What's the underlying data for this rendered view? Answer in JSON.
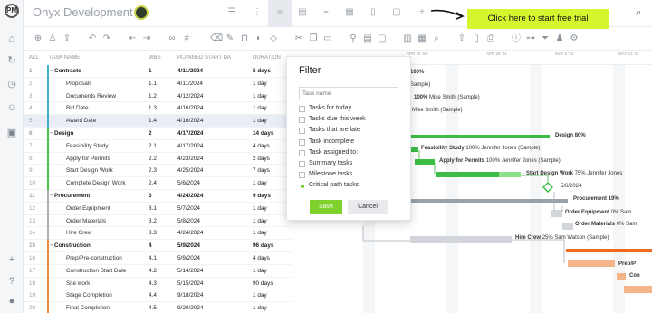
{
  "app": {
    "project_title": "Onyx Development",
    "cta_label": "Click here to start free trial"
  },
  "grid": {
    "columns": [
      "ALL",
      "TASK NAME",
      "WBS",
      "PLANNED START DA",
      "DURATION"
    ],
    "rows": [
      {
        "num": "1",
        "name": "Contracts",
        "wbs": "1",
        "start": "4/11/2024",
        "dur": "5 days",
        "group": true,
        "color": "#3fb0c9"
      },
      {
        "num": "2",
        "name": "Proposals",
        "wbs": "1.1",
        "start": "4/11/2024",
        "dur": "1 day",
        "group": false,
        "color": "#3fb0c9"
      },
      {
        "num": "3",
        "name": "Documents Review",
        "wbs": "1.2",
        "start": "4/12/2024",
        "dur": "1 day",
        "group": false,
        "color": "#3fb0c9"
      },
      {
        "num": "4",
        "name": "Bid Date",
        "wbs": "1.3",
        "start": "4/16/2024",
        "dur": "1 day",
        "group": false,
        "color": "#3fb0c9"
      },
      {
        "num": "5",
        "name": "Award Date",
        "wbs": "1.4",
        "start": "4/16/2024",
        "dur": "1 day",
        "group": false,
        "color": "#3fb0c9",
        "selected": true
      },
      {
        "num": "6",
        "name": "Design",
        "wbs": "2",
        "start": "4/17/2024",
        "dur": "14 days",
        "group": true,
        "color": "#4cc34a"
      },
      {
        "num": "7",
        "name": "Feasibility Study",
        "wbs": "2.1",
        "start": "4/17/2024",
        "dur": "4 days",
        "group": false,
        "color": "#4cc34a"
      },
      {
        "num": "8",
        "name": "Apply for Permits",
        "wbs": "2.2",
        "start": "4/23/2024",
        "dur": "2 days",
        "group": false,
        "color": "#4cc34a"
      },
      {
        "num": "9",
        "name": "Start Design Work",
        "wbs": "2.3",
        "start": "4/25/2024",
        "dur": "7 days",
        "group": false,
        "color": "#4cc34a"
      },
      {
        "num": "10",
        "name": "Complete Design Work",
        "wbs": "2.4",
        "start": "5/6/2024",
        "dur": "1 day",
        "group": false,
        "color": "#4cc34a"
      },
      {
        "num": "11",
        "name": "Procurement",
        "wbs": "3",
        "start": "4/24/2024",
        "dur": "9 days",
        "group": true,
        "color": "#a9b0b8"
      },
      {
        "num": "12",
        "name": "Order Equipment",
        "wbs": "3.1",
        "start": "5/7/2024",
        "dur": "1 day",
        "group": false,
        "color": "#a9b0b8"
      },
      {
        "num": "13",
        "name": "Order Materials",
        "wbs": "3.2",
        "start": "5/8/2024",
        "dur": "1 day",
        "group": false,
        "color": "#a9b0b8"
      },
      {
        "num": "14",
        "name": "Hire Crew",
        "wbs": "3.3",
        "start": "4/24/2024",
        "dur": "1 day",
        "group": false,
        "color": "#a9b0b8"
      },
      {
        "num": "15",
        "name": "Construction",
        "wbs": "4",
        "start": "5/9/2024",
        "dur": "96 days",
        "group": true,
        "color": "#ef8a3c"
      },
      {
        "num": "16",
        "name": "Prep/Pre-construction",
        "wbs": "4.1",
        "start": "5/9/2024",
        "dur": "4 days",
        "group": false,
        "color": "#ef8a3c"
      },
      {
        "num": "17",
        "name": "Construction Start Date",
        "wbs": "4.2",
        "start": "5/14/2024",
        "dur": "1 day",
        "group": false,
        "color": "#ef8a3c"
      },
      {
        "num": "18",
        "name": "Site work",
        "wbs": "4.3",
        "start": "5/15/2024",
        "dur": "90 days",
        "group": false,
        "color": "#ef8a3c"
      },
      {
        "num": "19",
        "name": "Stage Completion",
        "wbs": "4.4",
        "start": "9/18/2024",
        "dur": "1 day",
        "group": false,
        "color": "#ef8a3c"
      },
      {
        "num": "20",
        "name": "Final Completion",
        "wbs": "4.5",
        "start": "9/20/2024",
        "dur": "1 day",
        "group": false,
        "color": "#ef8a3c"
      }
    ]
  },
  "gantt": {
    "header_dates": [
      "APR 28 '24",
      "APR 28 '24",
      "MAY 5 '24",
      "MAY 12 '24"
    ],
    "labels": [
      {
        "text": "100%",
        "extra": ""
      },
      {
        "text": "",
        "extra": "Sample)"
      },
      {
        "text": "100%",
        "extra": "Mike Smith (Sample)"
      },
      {
        "text": "",
        "extra": "Mike Smith (Sample)"
      },
      {
        "text": "Design",
        "extra": "80%"
      },
      {
        "text": "Feasibility Study",
        "extra": "100%  Jennifer Jones (Sample)"
      },
      {
        "text": "Apply for Permits",
        "extra": "100%  Jennifer Jones (Sample)"
      },
      {
        "text": "Start Design Work",
        "extra": "75%  Jennifer Jones"
      },
      {
        "text": "5/6/2024",
        "extra": ""
      },
      {
        "text": "Procurement",
        "extra": "19%"
      },
      {
        "text": "Order Equipment",
        "extra": "0%  Sam"
      },
      {
        "text": "Order Materials",
        "extra": "0%  Sam"
      },
      {
        "text": "Hire Crew",
        "extra": "25%  Sam Watson (Sample)"
      },
      {
        "text": "Prep/P",
        "extra": ""
      },
      {
        "text": "Con",
        "extra": ""
      }
    ]
  },
  "filter": {
    "title": "Filter",
    "placeholder": "Task name",
    "options": [
      "Tasks for today",
      "Tasks due this week",
      "Tasks that are late",
      "Task incomplete",
      "Task assigned to:",
      "Summary tasks",
      "Milestone tasks",
      "Critical path tasks"
    ],
    "save_label": "Save",
    "cancel_label": "Cancel"
  }
}
